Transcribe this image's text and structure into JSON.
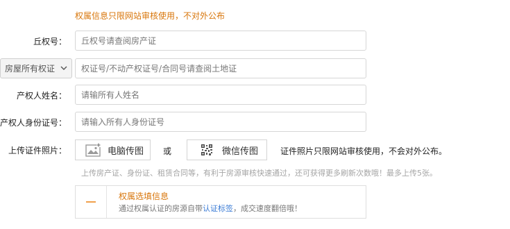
{
  "notice": "权属信息只限网站审核使用，不对外公布",
  "fields": {
    "qiquan": {
      "label": "丘权号：",
      "placeholder": "丘权号请查阅房产证"
    },
    "certificate": {
      "select_value": "房屋所有权证",
      "placeholder": "权证号/不动产权证号/合同号请查阅土地证"
    },
    "owner_name": {
      "label": "产权人姓名：",
      "placeholder": "请输所有人姓名"
    },
    "owner_id": {
      "label": "产权人身份证号：",
      "placeholder": "请输入所有人身份证号"
    }
  },
  "upload": {
    "label": "上传证件照片：",
    "pc_button": "电脑传图",
    "or": "或",
    "wechat_button": "微信传图",
    "note": "证件照片只限网站审核使用，不会对外公布。",
    "tip": "上传房产证、身份证、租赁合同等，有利于房源审核快速通过，还可获得更多刷新次数哦！最多上传5张。"
  },
  "optional_card": {
    "title": "权属选填信息",
    "desc_prefix": "通过权属认证的房源自带",
    "desc_link": "认证标签",
    "desc_suffix": "，成交速度翻倍哦！"
  },
  "colors": {
    "accent_orange": "#d8760b",
    "link_blue": "#3a7bd5"
  }
}
